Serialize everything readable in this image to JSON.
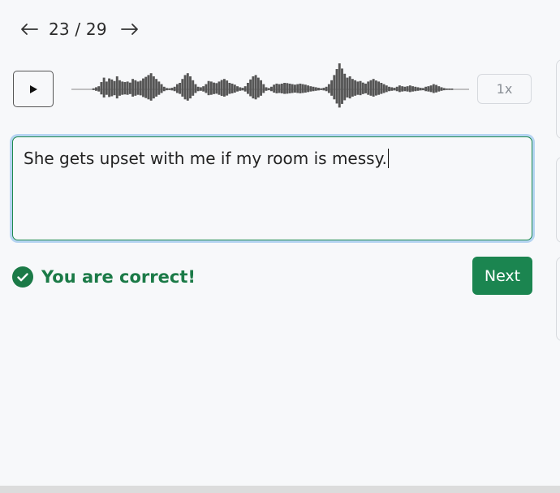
{
  "nav": {
    "prev_icon": "arrow-left-icon",
    "next_icon": "arrow-right-icon",
    "counter": "23 / 29"
  },
  "player": {
    "play_icon": "play-icon",
    "speed_label": "1x",
    "wave_color": "#555555",
    "waveform": [
      0,
      0,
      0,
      0,
      0,
      0,
      0,
      0,
      0.04,
      0.08,
      0.12,
      0.28,
      0.45,
      0.3,
      0.42,
      0.38,
      0.32,
      0.5,
      0.35,
      0.3,
      0.28,
      0.3,
      0.26,
      0.4,
      0.35,
      0.3,
      0.33,
      0.42,
      0.48,
      0.55,
      0.62,
      0.5,
      0.4,
      0.3,
      0.2,
      0.1,
      0.05,
      0.04,
      0.06,
      0.1,
      0.2,
      0.25,
      0.4,
      0.55,
      0.62,
      0.5,
      0.35,
      0.2,
      0.1,
      0.08,
      0.12,
      0.2,
      0.32,
      0.3,
      0.26,
      0.24,
      0.3,
      0.36,
      0.4,
      0.34,
      0.25,
      0.22,
      0.18,
      0.12,
      0.08,
      0.06,
      0.12,
      0.25,
      0.38,
      0.5,
      0.55,
      0.45,
      0.35,
      0.2,
      0.08,
      0.05,
      0.1,
      0.18,
      0.22,
      0.2,
      0.22,
      0.25,
      0.24,
      0.22,
      0.2,
      0.18,
      0.2,
      0.22,
      0.2,
      0.18,
      0.15,
      0.12,
      0.1,
      0.08,
      0.06,
      0.04,
      0.06,
      0.1,
      0.2,
      0.35,
      0.55,
      0.78,
      1.0,
      0.8,
      0.6,
      0.45,
      0.5,
      0.4,
      0.35,
      0.3,
      0.32,
      0.26,
      0.22,
      0.3,
      0.35,
      0.4,
      0.34,
      0.3,
      0.25,
      0.2,
      0.15,
      0.1,
      0.08,
      0.06,
      0.1,
      0.15,
      0.12,
      0.1,
      0.12,
      0.15,
      0.12,
      0.1,
      0.08,
      0.06,
      0.05,
      0.1,
      0.12,
      0.15,
      0.2,
      0.17,
      0.12,
      0.08,
      0.05,
      0.03,
      0.02,
      0.01,
      0,
      0,
      0,
      0,
      0,
      0
    ]
  },
  "answer": {
    "text": "She gets upset with me if my room is messy."
  },
  "result": {
    "icon": "check-circle-icon",
    "message": "You are correct!",
    "color": "#1b7a47"
  },
  "actions": {
    "next_label": "Next",
    "next_color": "#1b8550"
  }
}
